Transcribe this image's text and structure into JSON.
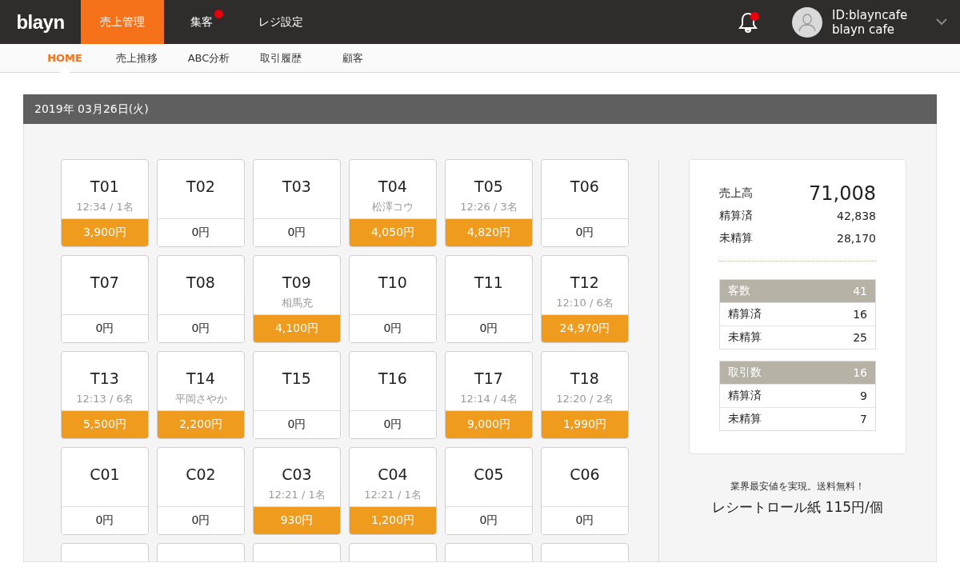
{
  "header": {
    "logo": "blayn",
    "tabs": [
      {
        "label": "売上管理",
        "selected": true,
        "badge": false
      },
      {
        "label": "集客",
        "selected": false,
        "badge": true
      },
      {
        "label": "レジ設定",
        "selected": false,
        "badge": false
      }
    ],
    "notification_badge": true,
    "account": {
      "id": "ID:blayncafe",
      "name": "blayn cafe"
    }
  },
  "subnav": [
    {
      "label": "HOME",
      "selected": true
    },
    {
      "label": "売上推移",
      "selected": false
    },
    {
      "label": "ABC分析",
      "selected": false
    },
    {
      "label": "取引履歴",
      "selected": false
    },
    {
      "label": "顧客",
      "selected": false
    }
  ],
  "date": "2019年 03月26日(火)",
  "tables": [
    {
      "name": "T01",
      "info": "12:34 / 1名",
      "amount": "3,900円",
      "occupied": true
    },
    {
      "name": "T02",
      "amount": "0円",
      "occupied": false
    },
    {
      "name": "T03",
      "amount": "0円",
      "occupied": false
    },
    {
      "name": "T04",
      "info": "松澤コウ",
      "amount": "4,050円",
      "occupied": true
    },
    {
      "name": "T05",
      "info": "12:26 / 3名",
      "amount": "4,820円",
      "occupied": true
    },
    {
      "name": "T06",
      "amount": "0円",
      "occupied": false
    },
    {
      "name": "T07",
      "amount": "0円",
      "occupied": false
    },
    {
      "name": "T08",
      "amount": "0円",
      "occupied": false
    },
    {
      "name": "T09",
      "info": "相馬充",
      "amount": "4,100円",
      "occupied": true
    },
    {
      "name": "T10",
      "amount": "0円",
      "occupied": false
    },
    {
      "name": "T11",
      "amount": "0円",
      "occupied": false
    },
    {
      "name": "T12",
      "info": "12:10 / 6名",
      "amount": "24,970円",
      "occupied": true
    },
    {
      "name": "T13",
      "info": "12:13 / 6名",
      "amount": "5,500円",
      "occupied": true
    },
    {
      "name": "T14",
      "info": "平岡さやか",
      "amount": "2,200円",
      "occupied": true
    },
    {
      "name": "T15",
      "amount": "0円",
      "occupied": false
    },
    {
      "name": "T16",
      "amount": "0円",
      "occupied": false
    },
    {
      "name": "T17",
      "info": "12:14 / 4名",
      "amount": "9,000円",
      "occupied": true
    },
    {
      "name": "T18",
      "info": "12:20 / 2名",
      "amount": "1,990円",
      "occupied": true
    },
    {
      "name": "C01",
      "amount": "0円",
      "occupied": false
    },
    {
      "name": "C02",
      "amount": "0円",
      "occupied": false
    },
    {
      "name": "C03",
      "info": "12:21 / 1名",
      "amount": "930円",
      "occupied": true
    },
    {
      "name": "C04",
      "info": "12:21 / 1名",
      "amount": "1,200円",
      "occupied": true
    },
    {
      "name": "C05",
      "amount": "0円",
      "occupied": false
    },
    {
      "name": "C06",
      "amount": "0円",
      "occupied": false
    }
  ],
  "summary": {
    "sales": {
      "label": "売上高",
      "value": "71,008"
    },
    "sales_rows": [
      {
        "label": "精算済",
        "value": "42,838"
      },
      {
        "label": "未精算",
        "value": "28,170"
      }
    ],
    "groups": [
      {
        "label": "客数",
        "value": "41",
        "rows": [
          {
            "label": "精算済",
            "value": "16"
          },
          {
            "label": "未精算",
            "value": "25"
          }
        ]
      },
      {
        "label": "取引数",
        "value": "16",
        "rows": [
          {
            "label": "精算済",
            "value": "9"
          },
          {
            "label": "未精算",
            "value": "7"
          }
        ]
      }
    ]
  },
  "ad": {
    "line1": "業界最安値を実現。送料無料！",
    "line2": "レシートロール紙 115円/個"
  }
}
